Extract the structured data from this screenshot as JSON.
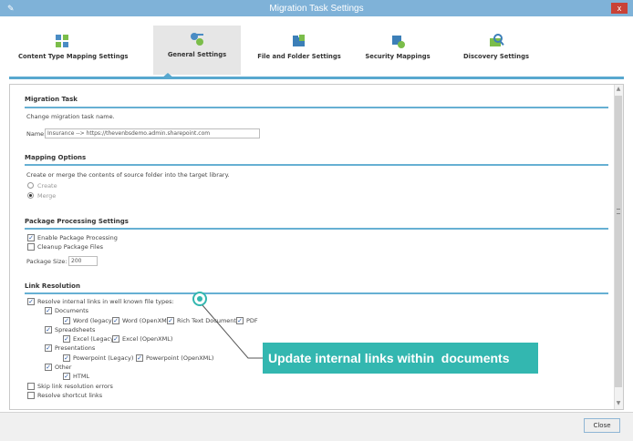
{
  "window": {
    "title": "Migration Task Settings",
    "left_icon": "✎",
    "close_glyph": "x"
  },
  "ribbon": {
    "tabs": [
      {
        "label": "Content Type Mapping Settings",
        "icon": "content-type-mapping-icon"
      },
      {
        "label": "General Settings",
        "icon": "general-settings-icon"
      },
      {
        "label": "File and Folder Settings",
        "icon": "file-folder-icon"
      },
      {
        "label": "Security Mappings",
        "icon": "security-mappings-icon"
      },
      {
        "label": "Discovery Settings",
        "icon": "discovery-settings-icon"
      }
    ],
    "active_tab": "General Settings"
  },
  "migration_task": {
    "title": "Migration Task",
    "description": "Change migration task name.",
    "name_label": "Name:",
    "name_value": "Insurance --> https://thevenbsdemo.admin.sharepoint.com"
  },
  "mapping_options": {
    "title": "Mapping Options",
    "description": "Create or merge the contents of source folder into the target library.",
    "options": [
      {
        "label": "Create",
        "selected": false
      },
      {
        "label": "Merge",
        "selected": true
      }
    ]
  },
  "package_processing": {
    "title": "Package Processing Settings",
    "enable_label": "Enable Package Processing",
    "enable_checked": true,
    "cleanup_label": "Cleanup Package Files",
    "cleanup_checked": false,
    "size_label": "Package Size:",
    "size_value": "200"
  },
  "link_resolution": {
    "title": "Link Resolution",
    "resolve_label": "Resolve internal links in well known file types:",
    "documents_label": "Documents",
    "documents_items": [
      "Word (legacy)",
      "Word (OpenXML)",
      "Rich Text Document",
      "PDF"
    ],
    "spreadsheets_label": "Spreadsheets",
    "spreadsheets_items": [
      "Excel (Legacy)",
      "Excel (OpenXML)"
    ],
    "presentations_label": "Presentations",
    "presentations_items": [
      "Powerpoint (Legacy)",
      "Powerpoint (OpenXML)"
    ],
    "other_label": "Other",
    "other_items": [
      "HTML"
    ],
    "skip_label": "Skip link resolution errors",
    "shortcut_label": "Resolve shortcut links"
  },
  "callout": {
    "text": "Update internal links within  documents",
    "color": "#33b7b0"
  },
  "footer": {
    "close_label": "Close"
  },
  "colors": {
    "titlebar": "#7fb2d8",
    "accent": "#58a8cf",
    "close_red": "#c94237"
  }
}
